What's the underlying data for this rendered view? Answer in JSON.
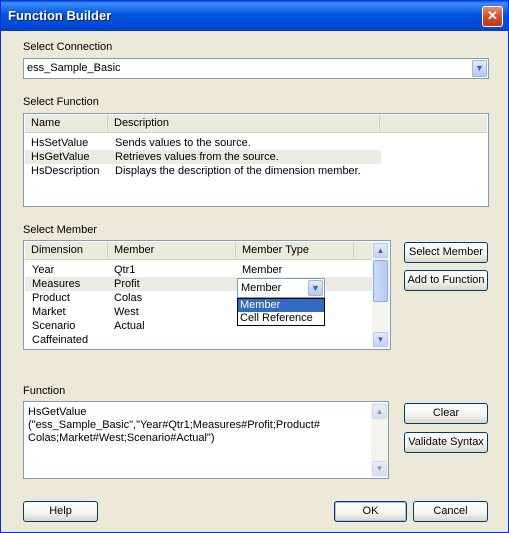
{
  "window": {
    "title": "Function Builder",
    "close_glyph": "✕"
  },
  "connection": {
    "label": "Select Connection",
    "value": "ess_Sample_Basic"
  },
  "function_list": {
    "label": "Select Function",
    "columns": [
      "Name",
      "Description"
    ],
    "rows": [
      {
        "name": "HsSetValue",
        "description": "Sends values to the source."
      },
      {
        "name": "HsGetValue",
        "description": "Retrieves values from the source."
      },
      {
        "name": "HsDescription",
        "description": "Displays the description of the dimension member."
      }
    ]
  },
  "member_grid": {
    "label": "Select Member",
    "columns": [
      "Dimension",
      "Member",
      "Member Type"
    ],
    "rows": [
      {
        "dimension": "Year",
        "member": "Qtr1",
        "type": "Member"
      },
      {
        "dimension": "Measures",
        "member": "Profit",
        "type": "Member"
      },
      {
        "dimension": "Product",
        "member": "Colas",
        "type": ""
      },
      {
        "dimension": "Market",
        "member": "West",
        "type": ""
      },
      {
        "dimension": "Scenario",
        "member": "Actual",
        "type": ""
      },
      {
        "dimension": "Caffeinated",
        "member": "",
        "type": ""
      }
    ],
    "type_options": [
      "Member",
      "Cell Reference"
    ]
  },
  "buttons": {
    "select_member": "Select Member",
    "add_to_function": "Add to Function",
    "clear": "Clear",
    "validate_syntax": "Validate Syntax",
    "help": "Help",
    "ok": "OK",
    "cancel": "Cancel"
  },
  "function_box": {
    "label": "Function",
    "lines": [
      "HsGetValue",
      "(\"ess_Sample_Basic\",\"Year#Qtr1;Measures#Profit;Product#",
      "Colas;Market#West;Scenario#Actual\")"
    ]
  },
  "icons": {
    "dropdown": "chevron-down-icon",
    "scroll_up": "arrow-up-icon",
    "scroll_down": "arrow-down-icon"
  }
}
